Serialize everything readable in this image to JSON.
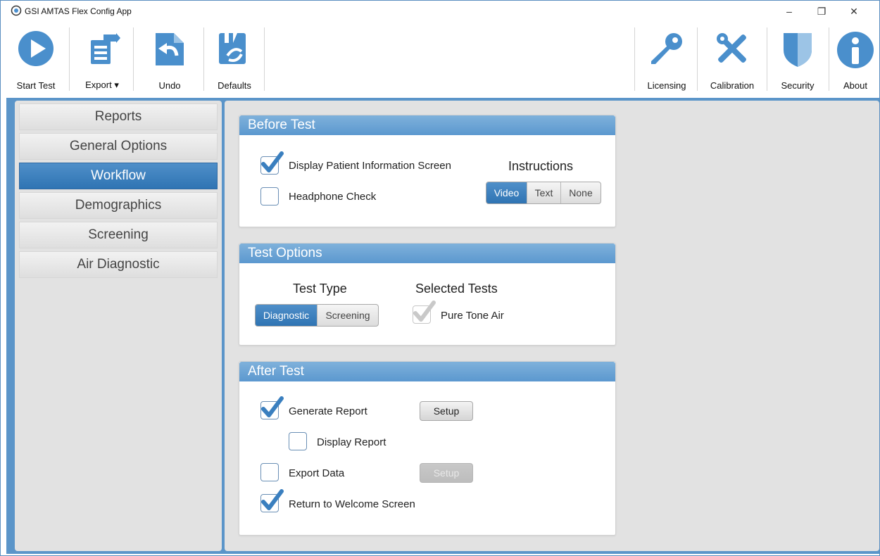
{
  "window": {
    "title": "GSI AMTAS Flex Config App",
    "minimize": "–",
    "maximize": "❐",
    "close": "✕"
  },
  "toolbar": {
    "start_test": "Start Test",
    "export": "Export",
    "export_arrow": "▾",
    "undo": "Undo",
    "defaults": "Defaults",
    "licensing": "Licensing",
    "calibration": "Calibration",
    "security": "Security",
    "about": "About"
  },
  "sidebar": {
    "items": [
      {
        "label": "Reports",
        "active": false
      },
      {
        "label": "General Options",
        "active": false
      },
      {
        "label": "Workflow",
        "active": true
      },
      {
        "label": "Demographics",
        "active": false
      },
      {
        "label": "Screening",
        "active": false
      },
      {
        "label": "Air Diagnostic",
        "active": false
      }
    ]
  },
  "before_test": {
    "title": "Before Test",
    "display_patient_info": {
      "label": "Display Patient Information Screen",
      "checked": true
    },
    "headphone_check": {
      "label": "Headphone Check",
      "checked": false
    },
    "instructions": {
      "label": "Instructions",
      "options": [
        "Video",
        "Text",
        "None"
      ],
      "selected": "Video"
    }
  },
  "test_options": {
    "title": "Test Options",
    "test_type": {
      "label": "Test Type",
      "options": [
        "Diagnostic",
        "Screening"
      ],
      "selected": "Diagnostic"
    },
    "selected_tests": {
      "label": "Selected Tests",
      "pure_tone_air": {
        "label": "Pure Tone Air",
        "checked": true,
        "disabled": true
      }
    }
  },
  "after_test": {
    "title": "After Test",
    "generate_report": {
      "label": "Generate Report",
      "checked": true,
      "setup_label": "Setup"
    },
    "display_report": {
      "label": "Display Report",
      "checked": false
    },
    "export_data": {
      "label": "Export Data",
      "checked": false,
      "setup_label": "Setup"
    },
    "return_welcome": {
      "label": "Return to Welcome Screen",
      "checked": true
    }
  },
  "colors": {
    "accent": "#3a7fbf",
    "accent_dark": "#2f74b3",
    "frame": "#5b95c9",
    "panel": "#e2e2e2"
  }
}
